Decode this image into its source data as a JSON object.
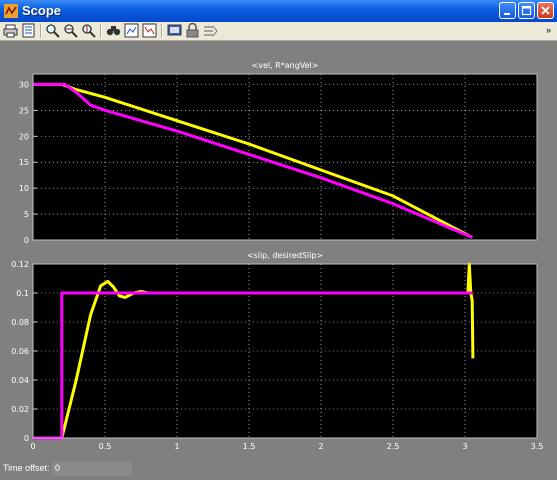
{
  "window": {
    "title": "Scope"
  },
  "toolbar": {
    "icons": [
      "print-icon",
      "parameters-icon",
      "zoom-icon",
      "zoom-x-icon",
      "zoom-y-icon",
      "autoscale-icon",
      "save-axes-icon",
      "restore-axes-icon",
      "floating-scope-icon",
      "lock-axes-icon",
      "signal-selection-icon"
    ],
    "overflow": "»"
  },
  "status": {
    "time_offset_label": "Time offset:",
    "time_offset_value": "0"
  },
  "colors": {
    "series1": "#ffff00",
    "series2": "#ff00ff",
    "plot_bg": "#000000",
    "tick_text": "#ffffff"
  },
  "chart_data": [
    {
      "type": "line",
      "title": "<vel, R*angVel>",
      "xlim": [
        0,
        3.5
      ],
      "ylim": [
        0,
        32
      ],
      "xticks": [],
      "yticks": [
        0,
        5,
        10,
        15,
        20,
        25,
        30
      ],
      "grid": true,
      "series": [
        {
          "color": "#ffff00",
          "x": [
            0,
            0.2,
            0.3,
            0.5,
            1.0,
            1.5,
            2.0,
            2.5,
            3.05
          ],
          "y": [
            30,
            30,
            29,
            27.5,
            23,
            18.5,
            13.5,
            8.5,
            0.5
          ]
        },
        {
          "color": "#ff00ff",
          "x": [
            0,
            0.22,
            0.3,
            0.4,
            0.5,
            1.0,
            1.5,
            2.0,
            2.5,
            3.05
          ],
          "y": [
            30,
            30,
            28.5,
            26,
            25,
            21,
            16.5,
            12,
            7,
            0.5
          ]
        }
      ]
    },
    {
      "type": "line",
      "title": "<slip, desiredSlip>",
      "xlim": [
        0,
        3.5
      ],
      "ylim": [
        0,
        0.12
      ],
      "xticks": [
        0,
        0.5,
        1,
        1.5,
        2,
        2.5,
        3,
        3.5
      ],
      "yticks": [
        0,
        0.02,
        0.04,
        0.06,
        0.08,
        0.1,
        0.12
      ],
      "grid": true,
      "series": [
        {
          "color": "#ffff00",
          "x": [
            0,
            0.2,
            0.3,
            0.4,
            0.47,
            0.52,
            0.56,
            0.6,
            0.64,
            0.7,
            0.75,
            0.8,
            0.9,
            1.0,
            3.0,
            3.02,
            3.03,
            3.04,
            3.05,
            3.055
          ],
          "y": [
            0,
            0,
            0.04,
            0.085,
            0.105,
            0.108,
            0.104,
            0.098,
            0.097,
            0.1,
            0.101,
            0.1,
            0.1,
            0.1,
            0.1,
            0.1,
            0.12,
            0.1,
            0.095,
            0.055
          ]
        },
        {
          "color": "#ff00ff",
          "x": [
            0,
            0.2,
            0.2,
            3.05
          ],
          "y": [
            0,
            0,
            0.1,
            0.1
          ]
        }
      ]
    }
  ]
}
